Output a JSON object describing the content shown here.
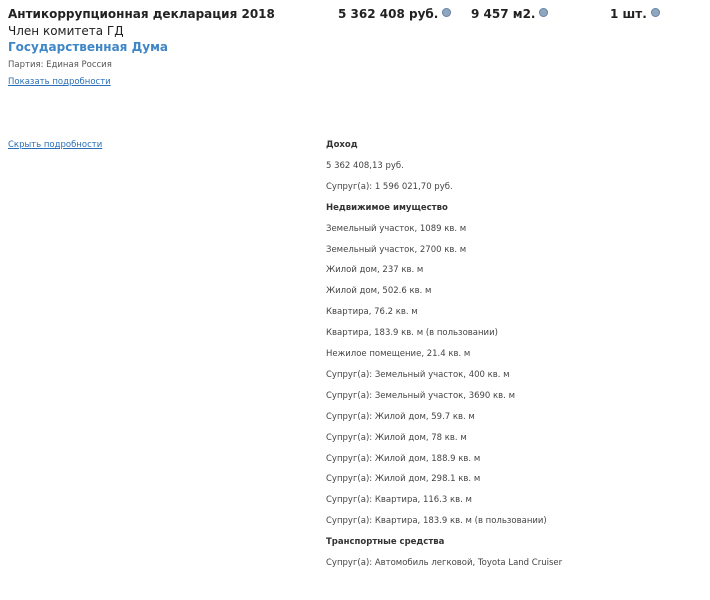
{
  "header": {
    "title": "Антикоррупционная декларация 2018",
    "income": "5 362 408 руб.",
    "area": "9 457 м2.",
    "vehicles": "1 шт."
  },
  "person": {
    "position": "Член комитета ГД",
    "organization": "Государственная Дума",
    "party": "Партия: Единая Россия"
  },
  "links": {
    "show_details": "Показать подробности",
    "hide_details": "Скрыть подробности"
  },
  "details": [
    {
      "text": "Доход",
      "heading": true
    },
    {
      "text": "5 362 408,13 руб.",
      "heading": false
    },
    {
      "text": "Супруг(а): 1 596 021,70 руб.",
      "heading": false
    },
    {
      "text": "Недвижимое имущество",
      "heading": true
    },
    {
      "text": "Земельный участок, 1089 кв. м",
      "heading": false
    },
    {
      "text": "Земельный участок, 2700 кв. м",
      "heading": false
    },
    {
      "text": "Жилой дом, 237 кв. м",
      "heading": false
    },
    {
      "text": "Жилой дом, 502.6 кв. м",
      "heading": false
    },
    {
      "text": "Квартира, 76.2 кв. м",
      "heading": false
    },
    {
      "text": "Квартира, 183.9 кв. м (в пользовании)",
      "heading": false
    },
    {
      "text": "Нежилое помещение, 21.4 кв. м",
      "heading": false
    },
    {
      "text": "Супруг(а): Земельный участок, 400 кв. м",
      "heading": false
    },
    {
      "text": "Супруг(а): Земельный участок, 3690 кв. м",
      "heading": false
    },
    {
      "text": "Супруг(а): Жилой дом, 59.7 кв. м",
      "heading": false
    },
    {
      "text": "Супруг(а): Жилой дом, 78 кв. м",
      "heading": false
    },
    {
      "text": "Супруг(а): Жилой дом, 188.9 кв. м",
      "heading": false
    },
    {
      "text": "Супруг(а): Жилой дом, 298.1 кв. м",
      "heading": false
    },
    {
      "text": "Супруг(а): Квартира, 116.3 кв. м",
      "heading": false
    },
    {
      "text": "Супруг(а): Квартира, 183.9 кв. м (в пользовании)",
      "heading": false
    },
    {
      "text": "Транспортные средства",
      "heading": true
    },
    {
      "text": "Супруг(а): Автомобиль легковой, Toyota Land Cruiser",
      "heading": false
    }
  ]
}
